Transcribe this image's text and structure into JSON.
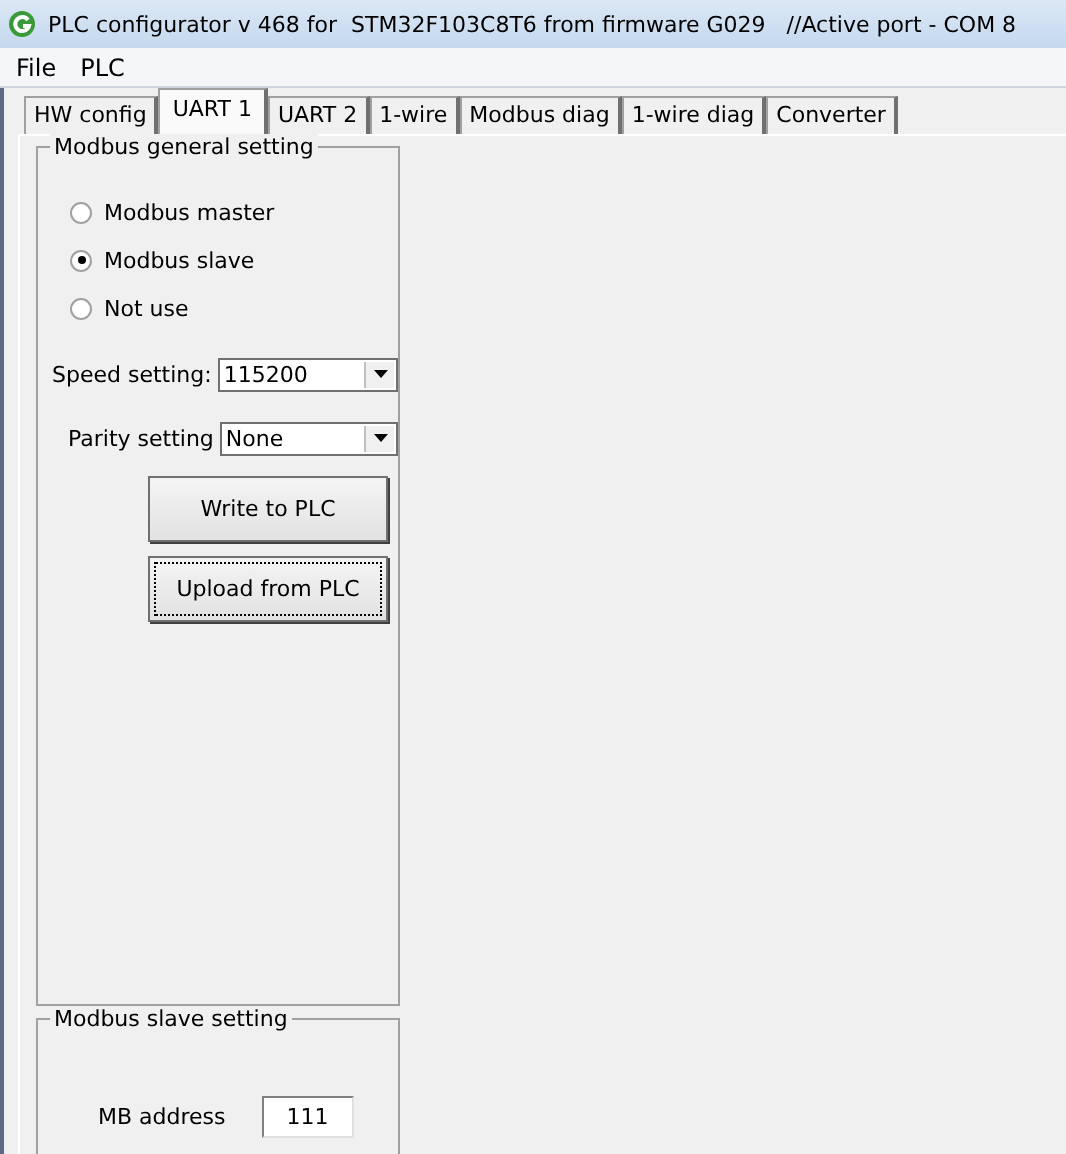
{
  "window": {
    "title": "PLC configurator v 468 for  STM32F103C8T6 from firmware G029   //Active port - COM 8"
  },
  "menu": [
    "File",
    "PLC"
  ],
  "tabs": [
    {
      "label": "HW config",
      "selected": false
    },
    {
      "label": "UART 1",
      "selected": true
    },
    {
      "label": "UART 2",
      "selected": false
    },
    {
      "label": "1-wire",
      "selected": false
    },
    {
      "label": "Modbus diag",
      "selected": false
    },
    {
      "label": "1-wire diag",
      "selected": false
    },
    {
      "label": "Converter",
      "selected": false
    }
  ],
  "general_group": {
    "title": "Modbus general setting",
    "modes": [
      {
        "label": "Modbus master",
        "selected": false
      },
      {
        "label": "Modbus slave",
        "selected": true
      },
      {
        "label": "Not use",
        "selected": false
      }
    ],
    "speed": {
      "label": "Speed setting:",
      "value": "115200"
    },
    "parity": {
      "label": "Parity setting",
      "value": "None"
    },
    "buttons": [
      {
        "label": "Write to PLC",
        "focused": false
      },
      {
        "label": "Upload from PLC",
        "focused": true
      }
    ]
  },
  "slave_group": {
    "title": "Modbus slave setting",
    "address": {
      "label": "MB address",
      "value": "111"
    }
  }
}
